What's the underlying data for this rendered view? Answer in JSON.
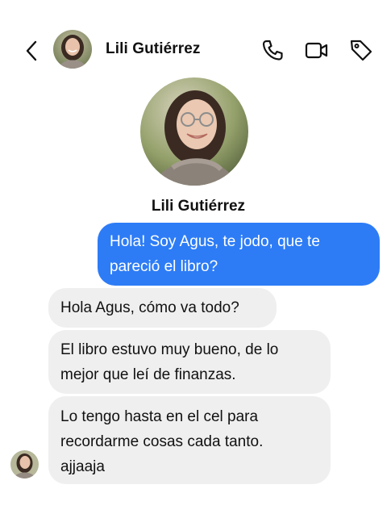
{
  "header": {
    "contact_name": "Lili Gutiérrez",
    "back_icon": "chevron-left-icon",
    "call_icon": "phone-icon",
    "video_icon": "video-camera-icon",
    "tag_icon": "tag-icon"
  },
  "profile": {
    "name": "Lili Gutiérrez"
  },
  "messages": [
    {
      "direction": "outgoing",
      "text_lines": [
        "Hola! Soy Agus, te jodo, que te",
        "pareció el libro?"
      ]
    },
    {
      "direction": "incoming",
      "text_lines": [
        "Hola Agus, cómo va todo?"
      ]
    },
    {
      "direction": "incoming",
      "text_lines": [
        "El libro estuvo muy bueno, de lo",
        "mejor que leí de finanzas."
      ]
    },
    {
      "direction": "incoming",
      "text_lines": [
        "Lo tengo hasta en el cel para",
        "recordarme cosas cada tanto.",
        "ajjaaja"
      ]
    }
  ],
  "colors": {
    "outgoing_bubble": "#2d7cf6",
    "incoming_bubble": "#efefef",
    "background": "#ffffff"
  }
}
